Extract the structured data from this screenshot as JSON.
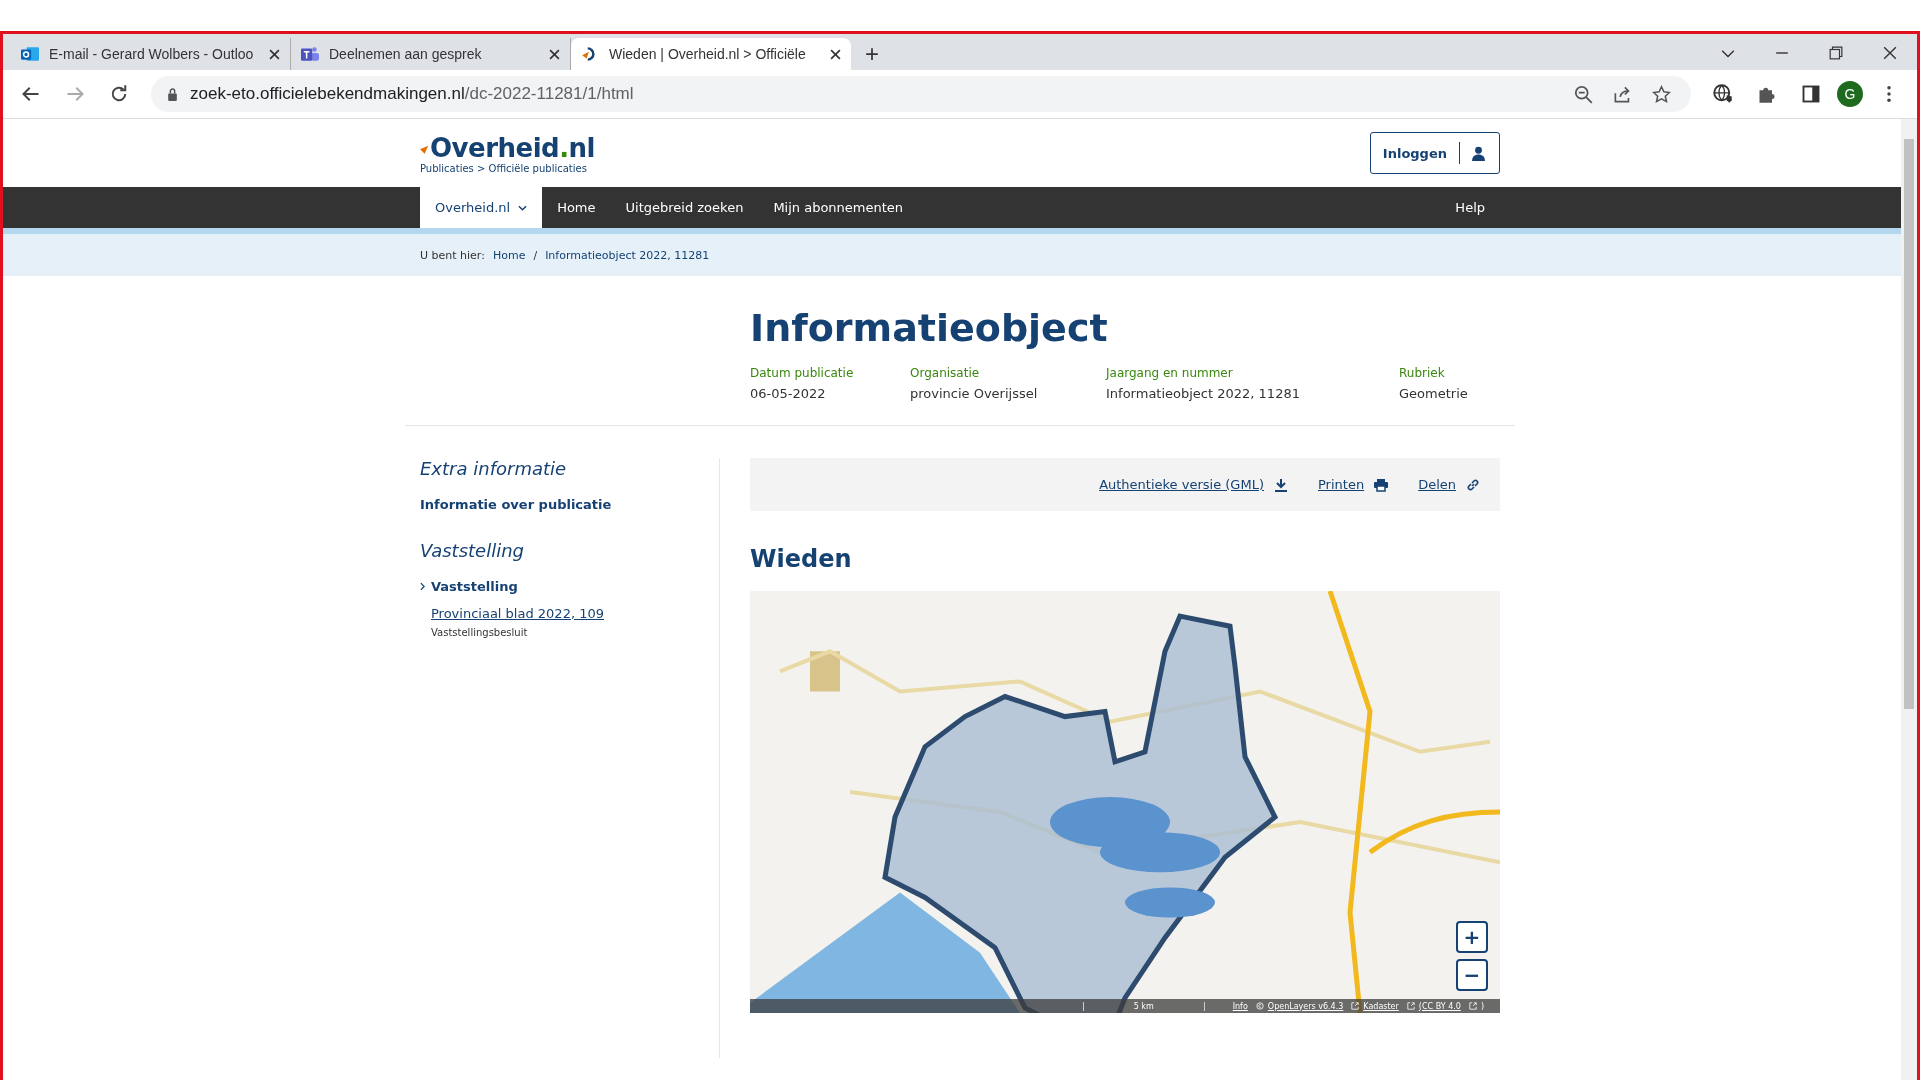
{
  "browser": {
    "tabs": [
      {
        "kind": "mail",
        "title": "E-mail - Gerard Wolbers - Outloo",
        "selected": false
      },
      {
        "kind": "teams",
        "title": "Deelnemen aan gesprek",
        "selected": false
      },
      {
        "kind": "site",
        "title": "Wieden | Overheid.nl > Officiële",
        "selected": true
      }
    ],
    "new_tab": "+",
    "url_host": "zoek-eto.officielebekendmakingen.nl",
    "url_path": "/dc-2022-11281/1/html",
    "profile": "G"
  },
  "header": {
    "logo_main": "Overheid",
    "logo_dot": ".",
    "logo_tld": "nl",
    "subtitle": "Publicaties > Officiële publicaties",
    "login": "Inloggen"
  },
  "nav": {
    "items": [
      {
        "label": "Overheid.nl",
        "selected": true,
        "dropdown": true
      },
      {
        "label": "Home",
        "selected": false,
        "dropdown": false
      },
      {
        "label": "Uitgebreid zoeken",
        "selected": false,
        "dropdown": false
      },
      {
        "label": "Mijn abonnementen",
        "selected": false,
        "dropdown": false
      }
    ],
    "help": "Help"
  },
  "breadcrumb": {
    "prefix": "U bent hier:",
    "items": [
      "Home",
      "Informatieobject 2022, 11281"
    ],
    "separator": "/"
  },
  "title": "Informatieobject",
  "meta": [
    {
      "label": "Datum publicatie",
      "value": "06-05-2022"
    },
    {
      "label": "Organisatie",
      "value": "provincie Overijssel"
    },
    {
      "label": "Jaargang en nummer",
      "value": "Informatieobject 2022, 11281"
    },
    {
      "label": "Rubriek",
      "value": "Geometrie"
    }
  ],
  "sidebar": {
    "sections": [
      {
        "heading": "Extra informatie",
        "items": [
          {
            "kind": "bold",
            "label": "Informatie over publicatie"
          }
        ]
      },
      {
        "heading": "Vaststelling",
        "items": [
          {
            "kind": "chevron",
            "label": "Vaststelling"
          },
          {
            "kind": "link",
            "label": "Provinciaal blad 2022, 109",
            "note": "Vaststellingsbesluit"
          }
        ]
      }
    ]
  },
  "actions": [
    {
      "kind": "download",
      "label": "Authentieke versie (GML)"
    },
    {
      "kind": "print",
      "label": "Printen"
    },
    {
      "kind": "share",
      "label": "Delen"
    }
  ],
  "section_title": "Wieden",
  "map": {
    "zoom_in": "+",
    "zoom_out": "−",
    "scale": "5 km",
    "info": "Info",
    "attribution": [
      {
        "kind": "copy",
        "label": "OpenLayers v6.4.3"
      },
      {
        "kind": "link",
        "label": "Kadaster"
      },
      {
        "kind": "paren",
        "label": "(CC BY 4.0"
      }
    ],
    "close_paren": ")"
  }
}
